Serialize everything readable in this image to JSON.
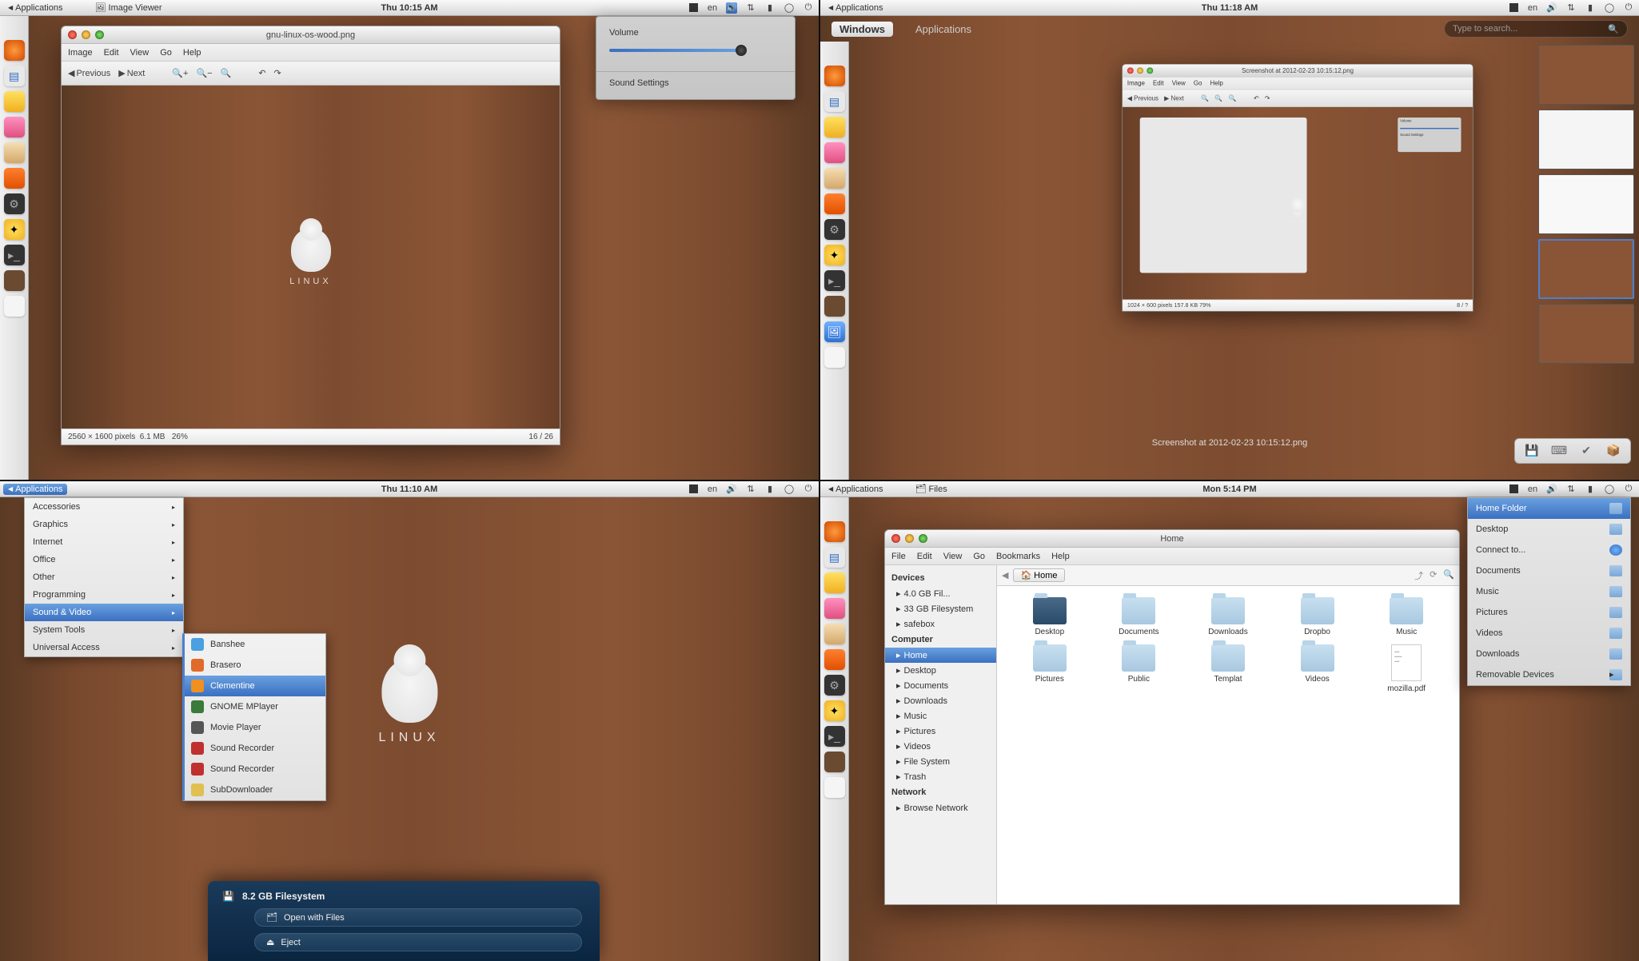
{
  "q1": {
    "topbar": {
      "apps": "Applications",
      "title": "Image Viewer",
      "clock": "Thu 10:15 AM",
      "lang": "en"
    },
    "win": {
      "title": "gnu-linux-os-wood.png",
      "menu": [
        "Image",
        "Edit",
        "View",
        "Go",
        "Help"
      ],
      "toolbar": {
        "prev": "Previous",
        "next": "Next"
      },
      "status": {
        "dims": "2560 × 1600 pixels",
        "size": "6.1 MB",
        "zoom": "26%",
        "pos": "16 / 26"
      },
      "linux": "LINUX"
    },
    "volume": {
      "heading": "Volume",
      "settings": "Sound Settings"
    }
  },
  "q2": {
    "topbar": {
      "apps": "Applications",
      "clock": "Thu 11:18 AM",
      "lang": "en"
    },
    "overview": {
      "tab_windows": "Windows",
      "tab_apps": "Applications",
      "search_placeholder": "Type to search...",
      "caption": "Screenshot at 2012-02-23 10:15:12.png",
      "preview_title": "Screenshot at 2012-02-23 10:15:12.png",
      "preview_status": "1024 × 600 pixels  157.8 KB   79%",
      "preview_pos": "8 / ?"
    }
  },
  "q3": {
    "topbar": {
      "apps": "Applications",
      "clock": "Thu 11:10 AM",
      "lang": "en"
    },
    "menu": {
      "cats": [
        "Accessories",
        "Graphics",
        "Internet",
        "Office",
        "Other",
        "Programming",
        "Sound & Video",
        "System Tools",
        "Universal Access"
      ],
      "selected": "Sound & Video",
      "sub": [
        "Banshee",
        "Brasero",
        "Clementine",
        "GNOME MPlayer",
        "Movie Player",
        "Sound Recorder",
        "Sound Recorder",
        "SubDownloader"
      ],
      "sub_selected": "Clementine"
    },
    "notif": {
      "title": "8.2 GB Filesystem",
      "open": "Open with Files",
      "eject": "Eject"
    },
    "linux": "LINUX"
  },
  "q4": {
    "topbar": {
      "apps": "Applications",
      "title": "Files",
      "clock": "Mon 5:14 PM",
      "lang": "en"
    },
    "fm": {
      "title": "Home",
      "menu": [
        "File",
        "Edit",
        "View",
        "Go",
        "Bookmarks",
        "Help"
      ],
      "crumb": "Home",
      "side": {
        "devices_h": "Devices",
        "devices": [
          "4.0 GB Fil...",
          "33 GB Filesystem",
          "safebox"
        ],
        "computer_h": "Computer",
        "computer": [
          "Home",
          "Desktop",
          "Documents",
          "Downloads",
          "Music",
          "Pictures",
          "Videos",
          "File System",
          "Trash"
        ],
        "network_h": "Network",
        "network": [
          "Browse Network"
        ],
        "selected": "Home"
      },
      "grid": [
        "Desktop",
        "Documents",
        "Downloads",
        "Dropbo",
        "Music",
        "Pictures",
        "Public",
        "Templat",
        "Videos",
        "mozilla.pdf"
      ]
    },
    "places": {
      "items": [
        "Home Folder",
        "Desktop",
        "Connect to...",
        "Documents",
        "Music",
        "Pictures",
        "Videos",
        "Downloads",
        "Removable Devices"
      ],
      "selected": "Home Folder"
    }
  }
}
